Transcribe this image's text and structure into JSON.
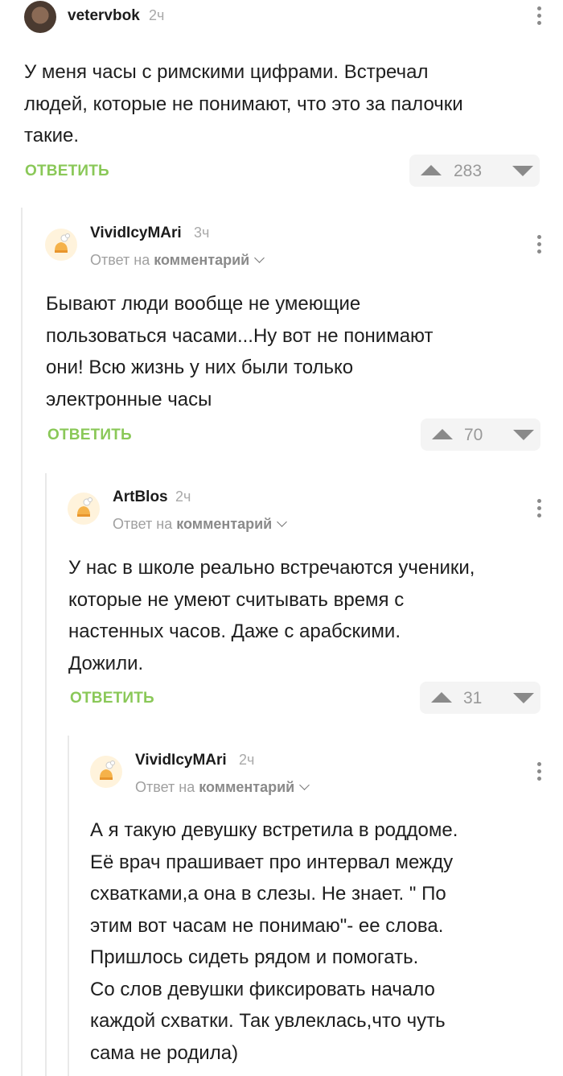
{
  "comments": [
    {
      "username": "vetervbok",
      "time": "2ч",
      "reply_prefix": "",
      "reply_target": "",
      "text": "У меня часы с римскими цифрами. Встречал\nлюдей, которые не понимают, что это за палочки\nтакие.",
      "reply_label": "ОТВЕТИТЬ",
      "votes": "283",
      "avatar_icon": "user-photo-avatar"
    },
    {
      "username": "VividIcyMAri",
      "time": "3ч",
      "reply_prefix": "Ответ на ",
      "reply_target": "комментарий",
      "text": "Бывают люди вообще не умеющие\nпользоваться часами...Ну вот не понимают\nони! Всю жизнь у них были только\nэлектронные часы",
      "reply_label": "ОТВЕТИТЬ",
      "votes": "70",
      "avatar_icon": "default-avatar-icon"
    },
    {
      "username": "ArtBlos",
      "time": "2ч",
      "reply_prefix": "Ответ на ",
      "reply_target": "комментарий",
      "text": "У нас в школе реально встречаются ученики,\nкоторые не умеют считывать время с\nнастенных часов. Даже с арабскими.\nДожили.",
      "reply_label": "ОТВЕТИТЬ",
      "votes": "31",
      "avatar_icon": "default-avatar-icon"
    },
    {
      "username": "VividIcyMAri",
      "time": "2ч",
      "reply_prefix": "Ответ на ",
      "reply_target": "комментарий",
      "text": "А я такую девушку встретила в роддоме.\nЕё врач прашивает про интервал между\nсхватками,а она в слезы. Не знает. \" По\nэтим вот часам не понимаю\"- ее слова.\nПришлось сидеть рядом и помогать.\nСо слов девушки фиксировать начало\nкаждой схватки. Так увлеклась,что чуть\nсама не родила)",
      "reply_label": "",
      "votes": "",
      "avatar_icon": "default-avatar-icon"
    }
  ],
  "colors": {
    "reply_green": "#8ac858",
    "muted_gray": "#a9a9a9",
    "thread_line": "#e9e9e9"
  }
}
